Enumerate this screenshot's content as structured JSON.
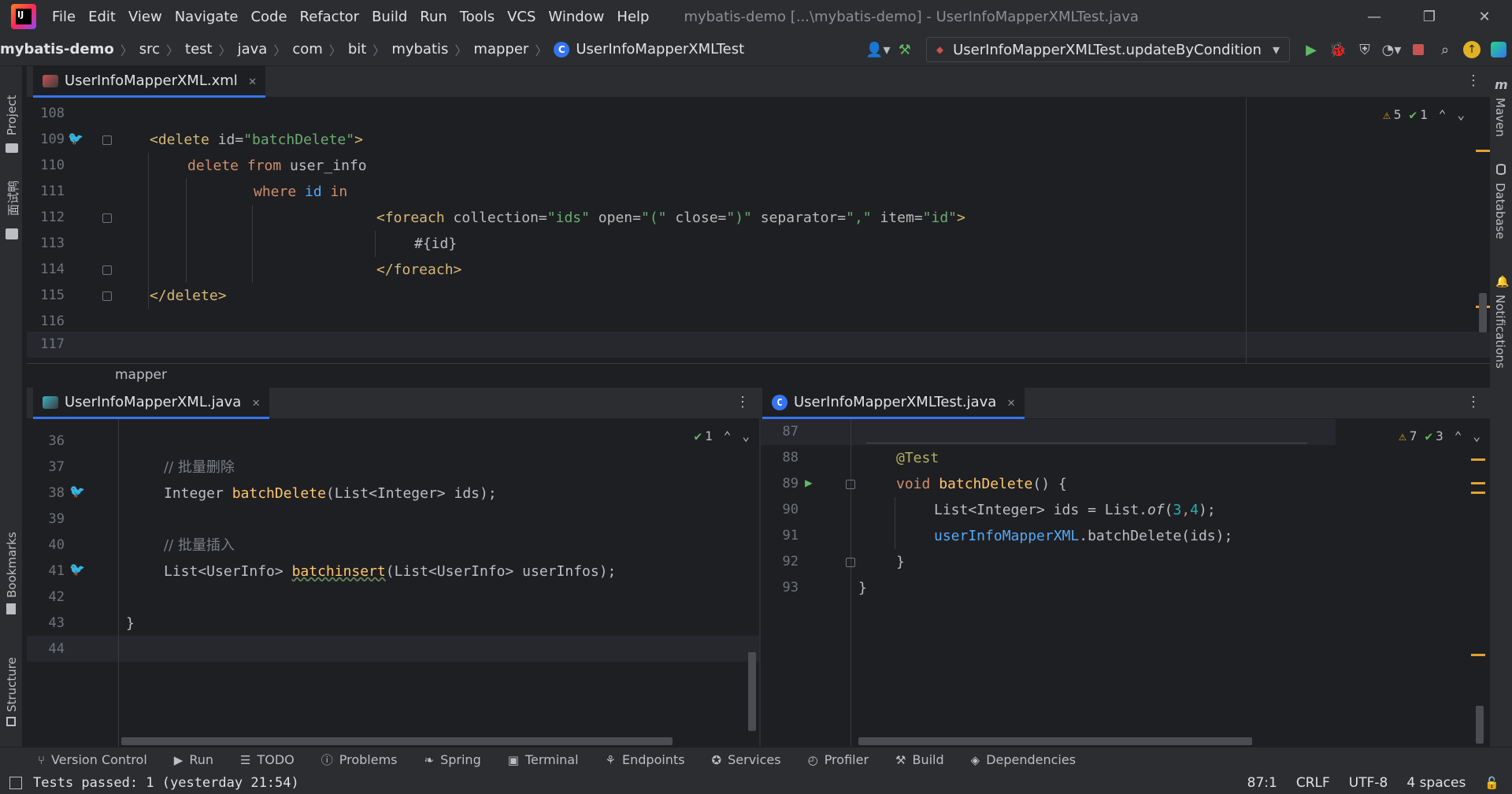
{
  "menubar": {
    "items": [
      "File",
      "Edit",
      "View",
      "Navigate",
      "Code",
      "Refactor",
      "Build",
      "Run",
      "Tools",
      "VCS",
      "Window",
      "Help"
    ],
    "window_title": "mybatis-demo [...\\mybatis-demo] - UserInfoMapperXMLTest.java"
  },
  "navbar": {
    "breadcrumbs": [
      "mybatis-demo",
      "src",
      "test",
      "java",
      "com",
      "bit",
      "mybatis",
      "mapper",
      "UserInfoMapperXMLTest"
    ],
    "run_config": "UserInfoMapperXMLTest.updateByCondition"
  },
  "left_stripe": {
    "project": "Project",
    "cn_tool": "面试鸭",
    "bookmarks": "Bookmarks",
    "structure": "Structure"
  },
  "right_stripe": {
    "maven": "Maven",
    "database": "Database",
    "notifications": "Notifications"
  },
  "top_editor": {
    "tab_label": "UserInfoMapperXML.xml",
    "warnings": "5",
    "oks": "1",
    "breadcrumb": "mapper",
    "line_numbers": [
      "108",
      "109",
      "110",
      "111",
      "112",
      "113",
      "114",
      "115",
      "116",
      "117"
    ],
    "lines": {
      "l109": {
        "open": "<delete ",
        "attr": "id=",
        "val": "\"batchDelete\"",
        "close": ">"
      },
      "l110": {
        "kw1": "delete ",
        "kw2": "from ",
        "plain": "user_info"
      },
      "l111": {
        "kw1": "where ",
        "id": "id ",
        "kw2": "in"
      },
      "l112": {
        "open": "<foreach ",
        "a1": "collection=",
        "v1": "\"ids\" ",
        "a2": "open=",
        "v2": "\"(\" ",
        "a3": "close=",
        "v3": "\")\" ",
        "a4": "separator=",
        "v4": "\",\" ",
        "a5": "item=",
        "v5": "\"id\"",
        "close": ">"
      },
      "l113": "#{id}",
      "l114": "</foreach>",
      "l115": "</delete>"
    }
  },
  "left_editor": {
    "tab_label": "UserInfoMapperXML.java",
    "oks": "1",
    "line_numbers": [
      "36",
      "37",
      "38",
      "39",
      "40",
      "41",
      "42",
      "43",
      "44"
    ],
    "lines": {
      "l37": "// 批量删除",
      "l38": {
        "t1": "Integer ",
        "fn": "batchDelete",
        "t2": "(List<Integer> ids);"
      },
      "l40": "// 批量插入",
      "l41": {
        "t1": "List<UserInfo> ",
        "fn": "batchinsert",
        "t2": "(List<UserInfo> userInfos);"
      },
      "l43": "}"
    }
  },
  "right_editor": {
    "tab_label": "UserInfoMapperXMLTest.java",
    "warnings": "7",
    "oks": "3",
    "line_numbers": [
      "87",
      "88",
      "89",
      "90",
      "91",
      "92",
      "93"
    ],
    "lines": {
      "l88": "@Test",
      "l89": {
        "kw": "void ",
        "fn": "batchDelete",
        "rest": "() {"
      },
      "l90": {
        "t1": "List<Integer> ids = List.",
        "m": "of",
        "p1": "(",
        "n1": "3",
        "c": ",",
        "n2": "4",
        "p2": ");"
      },
      "l91": {
        "field": "userInfoMapperXML",
        "rest": ".batchDelete(ids);"
      },
      "l92": "}",
      "l93": "}"
    }
  },
  "tool_windows": [
    "Version Control",
    "Run",
    "TODO",
    "Problems",
    "Spring",
    "Terminal",
    "Endpoints",
    "Services",
    "Profiler",
    "Build",
    "Dependencies"
  ],
  "status": {
    "message": "Tests passed: 1 (yesterday 21:54)",
    "position": "87:1",
    "line_sep": "CRLF",
    "encoding": "UTF-8",
    "indent": "4 spaces"
  },
  "colors": {
    "accent": "#3574f0",
    "warning": "#e0a234",
    "ok": "#5fb865",
    "run": "#5fb865"
  }
}
